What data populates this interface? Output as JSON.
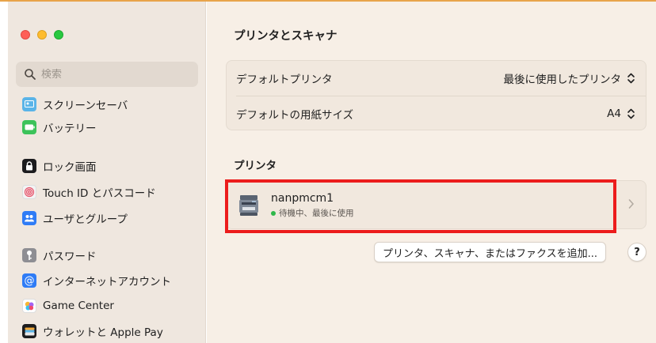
{
  "window": {
    "title": "プリンタとスキャナ"
  },
  "sidebar": {
    "search": {
      "placeholder": "検索",
      "value": ""
    },
    "items": [
      {
        "label": "スクリーンセーバ",
        "icon": "screensaver-icon",
        "color": "#5ab4e8"
      },
      {
        "label": "バッテリー",
        "icon": "battery-icon",
        "color": "#3cc35a"
      },
      {
        "label": "ロック画面",
        "icon": "lock-icon",
        "color": "#1c1c1e"
      },
      {
        "label": "Touch ID とパスコード",
        "icon": "fingerprint-icon",
        "color": "#f0f0f0"
      },
      {
        "label": "ユーザとグループ",
        "icon": "users-icon",
        "color": "#2f7cf6"
      },
      {
        "label": "パスワード",
        "icon": "key-icon",
        "color": "#8e8e93"
      },
      {
        "label": "インターネットアカウント",
        "icon": "at-icon",
        "color": "#2f7cf6"
      },
      {
        "label": "Game Center",
        "icon": "game-center-icon",
        "color": "#ffffff"
      },
      {
        "label": "ウォレットと Apple Pay",
        "icon": "wallet-icon",
        "color": "#1c1c1e"
      }
    ]
  },
  "defaults": {
    "default_printer_label": "デフォルトプリンタ",
    "default_printer_value": "最後に使用したプリンタ",
    "paper_size_label": "デフォルトの用紙サイズ",
    "paper_size_value": "A4"
  },
  "printers": {
    "section_title": "プリンタ",
    "items": [
      {
        "name": "nanpmcm1",
        "status": "待機中、最後に使用",
        "status_color": "#2fb84a"
      }
    ]
  },
  "actions": {
    "add_label": "プリンタ、スキャナ、またはファクスを追加...",
    "help_label": "?"
  },
  "colors": {
    "highlight": "#ec1c1c",
    "sidebar_bg": "#efe7df",
    "main_bg": "#f7efe6"
  }
}
